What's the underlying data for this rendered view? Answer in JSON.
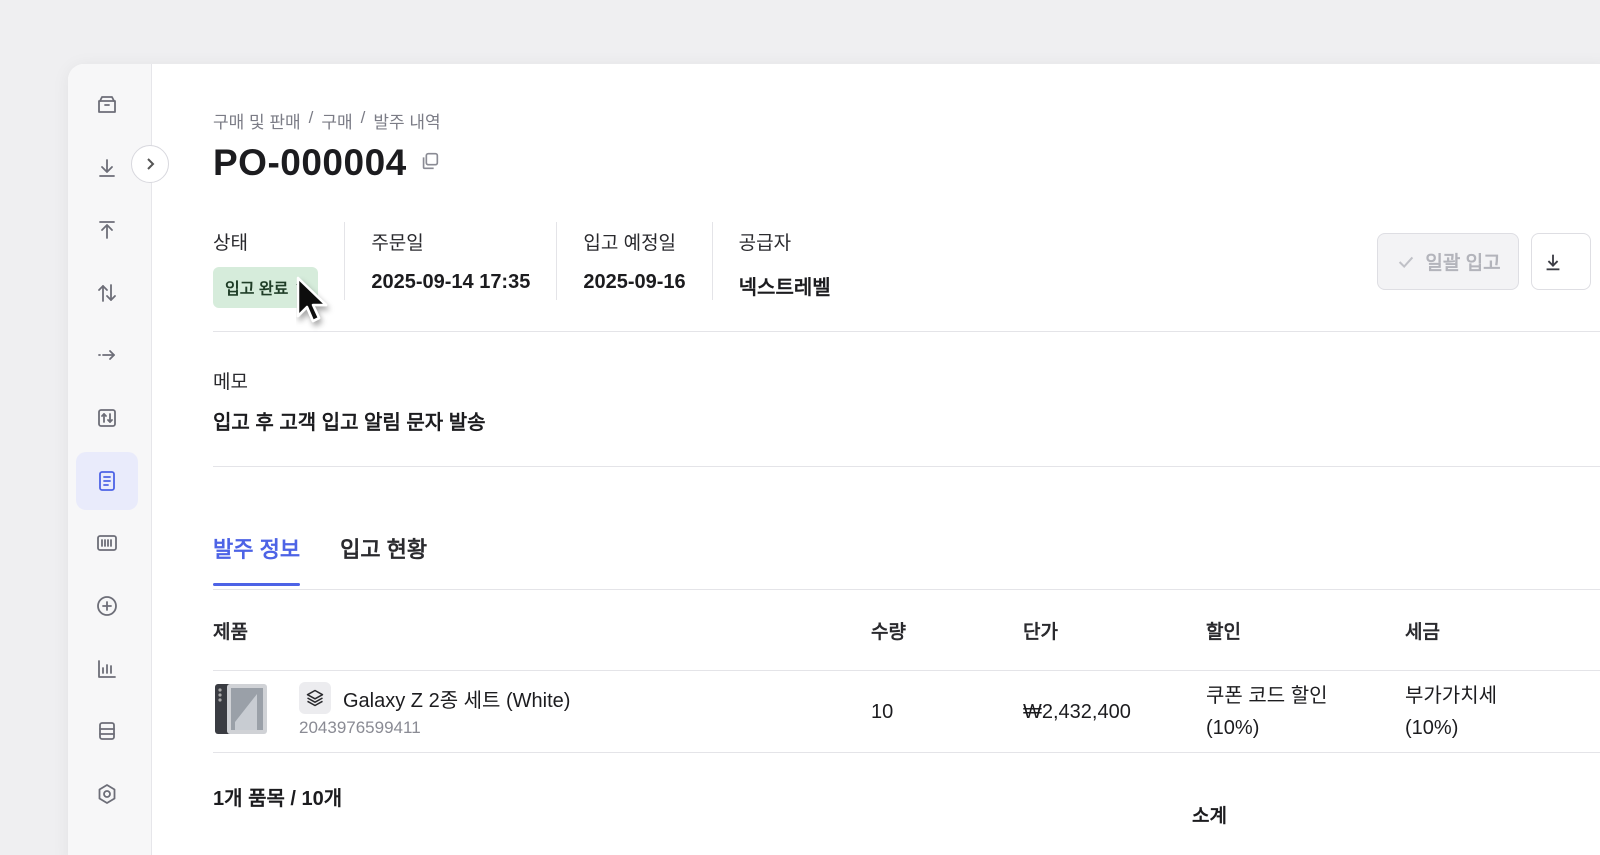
{
  "breadcrumb": [
    "구매 및 판매",
    "구매",
    "발주 내역"
  ],
  "breadcrumb_sep": "/",
  "title": "PO-000004",
  "meta": {
    "status_label": "상태",
    "status_value": "입고 완료",
    "order_date_label": "주문일",
    "order_date_value": "2025-09-14 17:35",
    "expected_label": "입고 예정일",
    "expected_value": "2025-09-16",
    "supplier_label": "공급자",
    "supplier_value": "넥스트레벨"
  },
  "actions": {
    "bulk_receive_label": "일괄 입고"
  },
  "memo": {
    "label": "메모",
    "text": "입고 후 고객 입고 알림 문자 발송"
  },
  "tabs": [
    {
      "label": "발주 정보",
      "active": true
    },
    {
      "label": "입고 현황",
      "active": false
    }
  ],
  "table": {
    "headers": {
      "product": "제품",
      "qty": "수량",
      "unit_price": "단가",
      "discount": "할인",
      "tax": "세금"
    },
    "rows": [
      {
        "name": "Galaxy Z 2종 세트 (White)",
        "sku": "2043976599411",
        "qty": "10",
        "unit_price": "₩2,432,400",
        "discount_line1": "쿠폰 코드 할인",
        "discount_line2": "(10%)",
        "tax_line1": "부가가치세",
        "tax_line2": "(10%)"
      }
    ]
  },
  "summary": "1개 품목 / 10개",
  "subtotal_label": "소계",
  "colors": {
    "accent": "#4d63e6",
    "status_bg": "#d6ecdb",
    "sidebar_active_bg": "#e9ebfb"
  },
  "sidebar_icons": [
    "box-icon",
    "download-icon",
    "upload-icon",
    "transfer-icon",
    "arrow-right-dotted-icon",
    "chart-box-icon",
    "document-icon",
    "barcode-icon",
    "plus-circle-icon",
    "bar-chart-icon",
    "database-icon",
    "settings-icon"
  ]
}
